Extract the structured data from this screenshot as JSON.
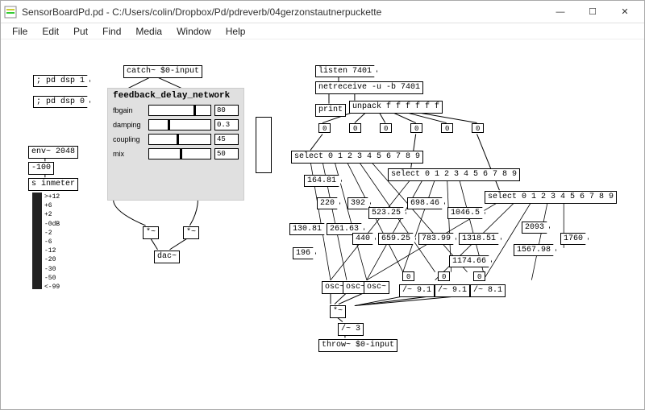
{
  "window": {
    "title": "SensorBoardPd.pd  - C:/Users/colin/Dropbox/Pd/pdreverb/04gerzonstautnerpuckette",
    "min": "—",
    "max": "☐",
    "close": "✕"
  },
  "menu": {
    "file": "File",
    "edit": "Edit",
    "put": "Put",
    "find": "Find",
    "media": "Media",
    "window": "Window",
    "help": "Help"
  },
  "left": {
    "dsp1": "; pd dsp 1",
    "dsp0": "; pd dsp 0",
    "env": "env~ 2048",
    "n100": "-100",
    "s_inmeter": "s inmeter",
    "vu_labels": [
      ">+12",
      "+6",
      "+2",
      "-0dB",
      "-2",
      "-6",
      "-12",
      "-20",
      "-30",
      "-50",
      "<-99"
    ]
  },
  "fdn": {
    "catch": "catch~ $0-input",
    "title": "feedback_delay_network",
    "rows": [
      {
        "label": "fbgain",
        "val": "80",
        "knob": 0.72
      },
      {
        "label": "damping",
        "val": "0.3",
        "knob": 0.3
      },
      {
        "label": "coupling",
        "val": "45",
        "knob": 0.45
      },
      {
        "label": "mix",
        "val": "50",
        "knob": 0.5
      }
    ],
    "mul1": "*~",
    "mul2": "*~",
    "dac": "dac~"
  },
  "net": {
    "listen": "listen 7401",
    "netreceive": "netreceive -u -b 7401",
    "print": "print",
    "unpack": "unpack f f f f f f",
    "select1": "select 0 1 2 3 4 5 6 7 8 9",
    "select2": "select 0 1 2 3 4 5 6 7 8 9",
    "select3": "select 0 1 2 3 4 5 6 7 8 9",
    "vals": {
      "v164": "164.81",
      "v220": "220",
      "v392": "392",
      "v523": "523.25",
      "v698": "698.46",
      "v1046": "1046.5",
      "v130": "130.81",
      "v261": "261.63",
      "v440": "440",
      "v659": "659.25",
      "v783": "783.99",
      "v1318": "1318.51",
      "v2093": "2093",
      "v196": "196",
      "v1174": "1174.66",
      "v1567": "1567.98",
      "v1760": "1760"
    },
    "div91a": "/~ 9.1",
    "div91b": "/~ 9.1",
    "div81": "/~ 8.1",
    "osc": "osc~",
    "mul": "*~",
    "div3": "/~ 3",
    "throw": "throw~ $0-input",
    "zero": "0",
    "tinyzero": "0"
  }
}
